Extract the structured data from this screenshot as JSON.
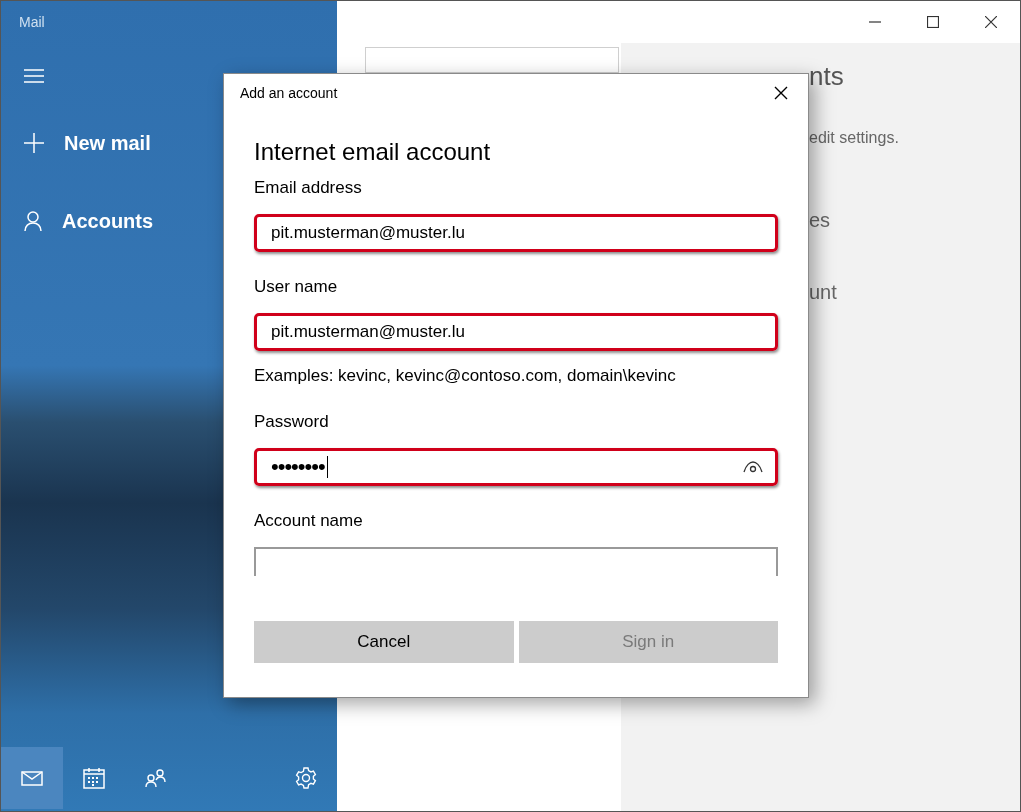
{
  "app": {
    "title": "Mail"
  },
  "sidebar": {
    "items": [
      {
        "kind": "compose",
        "label": "New mail"
      },
      {
        "kind": "accounts",
        "label": "Accounts"
      }
    ]
  },
  "bottom_nav": [
    {
      "kind": "mail",
      "selected": true
    },
    {
      "kind": "calendar",
      "selected": false
    },
    {
      "kind": "people",
      "selected": false
    },
    {
      "kind": "settings",
      "selected": false
    }
  ],
  "right_pane": {
    "fragments": [
      "nts",
      "edit settings.",
      "es",
      "unt"
    ]
  },
  "dialog": {
    "title": "Add an account",
    "heading": "Internet email account",
    "fields": [
      {
        "kind": "text",
        "label": "Email address",
        "value": "pit.musterman@muster.lu",
        "highlighted": true
      },
      {
        "kind": "text",
        "label": "User name",
        "value": "pit.musterman@muster.lu",
        "highlighted": true,
        "hint": "Examples: kevinc, kevinc@contoso.com, domain\\kevinc"
      },
      {
        "kind": "password",
        "label": "Password",
        "value": "••••••••",
        "highlighted": true
      },
      {
        "kind": "text",
        "label": "Account name",
        "highlighted": false
      }
    ],
    "buttons": [
      {
        "label": "Cancel",
        "disabled": false
      },
      {
        "label": "Sign in",
        "disabled": true
      }
    ]
  }
}
